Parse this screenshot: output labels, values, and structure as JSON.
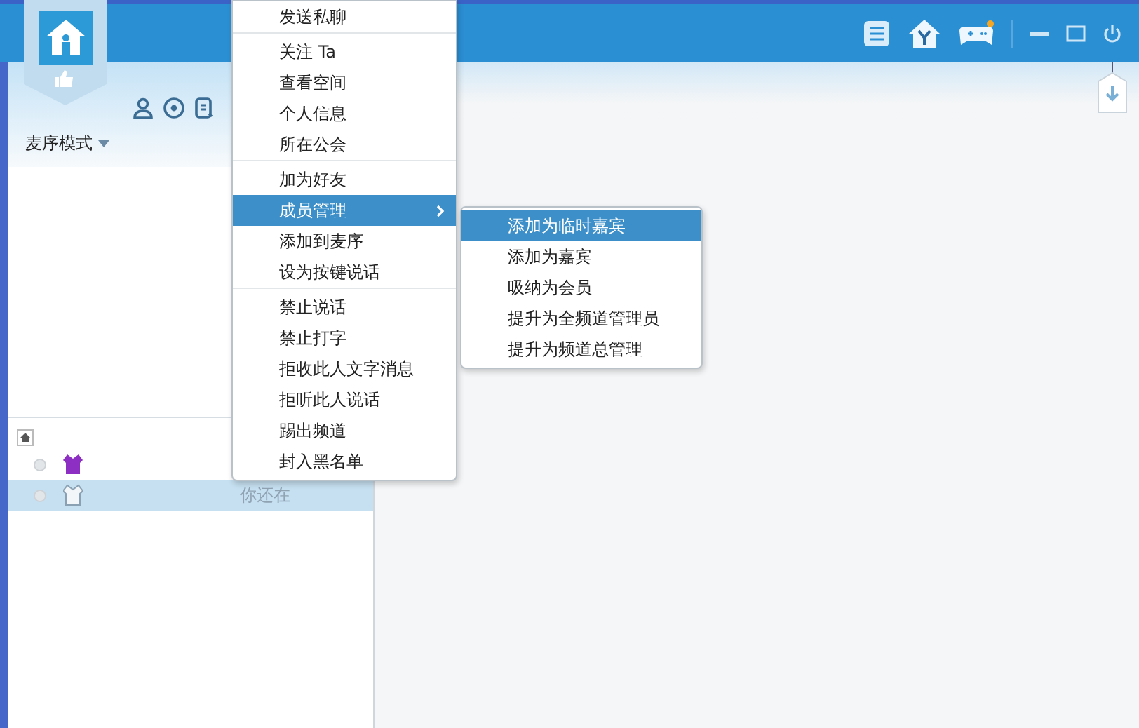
{
  "toolbar": {
    "mode_label": "麦序模式"
  },
  "user_list": [
    {
      "selected": false,
      "kind": "admin"
    },
    {
      "selected": true,
      "kind": "guest",
      "status": "你还在"
    }
  ],
  "context_menu": {
    "groups": [
      [
        {
          "label": "发送私聊",
          "selected": false
        }
      ],
      [
        {
          "label": "关注 Ta",
          "selected": false
        },
        {
          "label": "查看空间",
          "selected": false
        },
        {
          "label": "个人信息",
          "selected": false
        },
        {
          "label": "所在公会",
          "selected": false
        }
      ],
      [
        {
          "label": "加为好友",
          "selected": false
        },
        {
          "label": "成员管理",
          "selected": true,
          "submenu": true
        },
        {
          "label": "添加到麦序",
          "selected": false
        },
        {
          "label": "设为按键说话",
          "selected": false
        }
      ],
      [
        {
          "label": "禁止说话",
          "selected": false
        },
        {
          "label": "禁止打字",
          "selected": false
        },
        {
          "label": "拒收此人文字消息",
          "selected": false
        },
        {
          "label": "拒听此人说话",
          "selected": false
        },
        {
          "label": "踢出频道",
          "selected": false
        },
        {
          "label": "封入黑名单",
          "selected": false
        }
      ]
    ]
  },
  "submenu": [
    {
      "label": "添加为临时嘉宾",
      "selected": true
    },
    {
      "label": "添加为嘉宾",
      "selected": false
    },
    {
      "label": "吸纳为会员",
      "selected": false
    },
    {
      "label": "提升为全频道管理员",
      "selected": false
    },
    {
      "label": "提升为频道总管理",
      "selected": false
    }
  ]
}
